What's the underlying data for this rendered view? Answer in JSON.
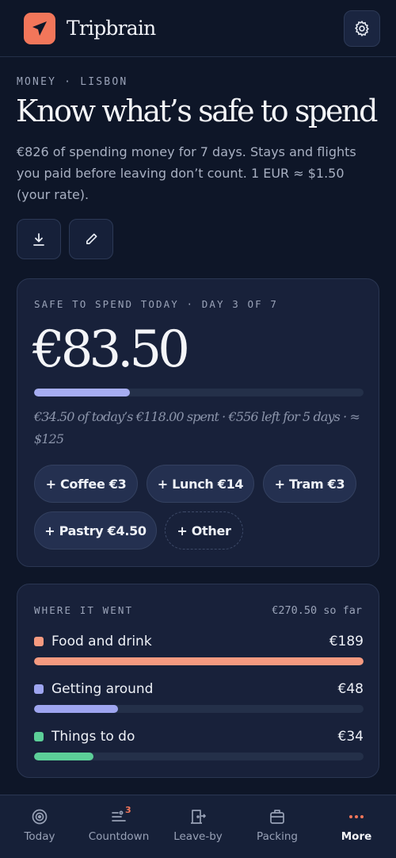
{
  "app": {
    "name": "Tripbrain"
  },
  "page": {
    "eyebrow": "MONEY · LISBON",
    "title": "Know what’s safe to spend",
    "subtitle": "€826 of spending money for 7 days. Stays and flights you paid before leaving don’t count. 1 EUR ≈ $1.50 (your rate)."
  },
  "actions": {
    "download_icon": "download-icon",
    "edit_icon": "pencil-icon"
  },
  "safe_card": {
    "eyebrow": "SAFE TO SPEND TODAY · DAY 3 OF 7",
    "amount": "€83.50",
    "progress_fraction": 0.29,
    "progress_color": "#a6adf2",
    "note": "€34.50 of today’s €118.00 spent · €556 left for 5 days · ≈ $125",
    "chips": [
      {
        "label": "+ Coffee €3"
      },
      {
        "label": "+ Lunch €14"
      },
      {
        "label": "+ Tram €3"
      },
      {
        "label": "+ Pastry €4.50"
      },
      {
        "label": "+ Other"
      }
    ]
  },
  "where_card": {
    "eyebrow": "WHERE IT WENT",
    "so_far": "€270.50 so far",
    "categories": [
      {
        "label": "Food and drink",
        "amount": "€189",
        "color": "#f59a80",
        "fraction": 1.0
      },
      {
        "label": "Getting around",
        "amount": "€48",
        "color": "#9ea5f0",
        "fraction": 0.254
      },
      {
        "label": "Things to do",
        "amount": "€34",
        "color": "#5ccf98",
        "fraction": 0.18
      }
    ]
  },
  "tabs": [
    {
      "label": "Today",
      "icon": "target-icon"
    },
    {
      "label": "Countdown",
      "icon": "countdown-icon",
      "badge": "3"
    },
    {
      "label": "Leave-by",
      "icon": "door-exit-icon"
    },
    {
      "label": "Packing",
      "icon": "suitcase-icon"
    },
    {
      "label": "More",
      "icon": "more-dots-icon",
      "active": true
    }
  ]
}
